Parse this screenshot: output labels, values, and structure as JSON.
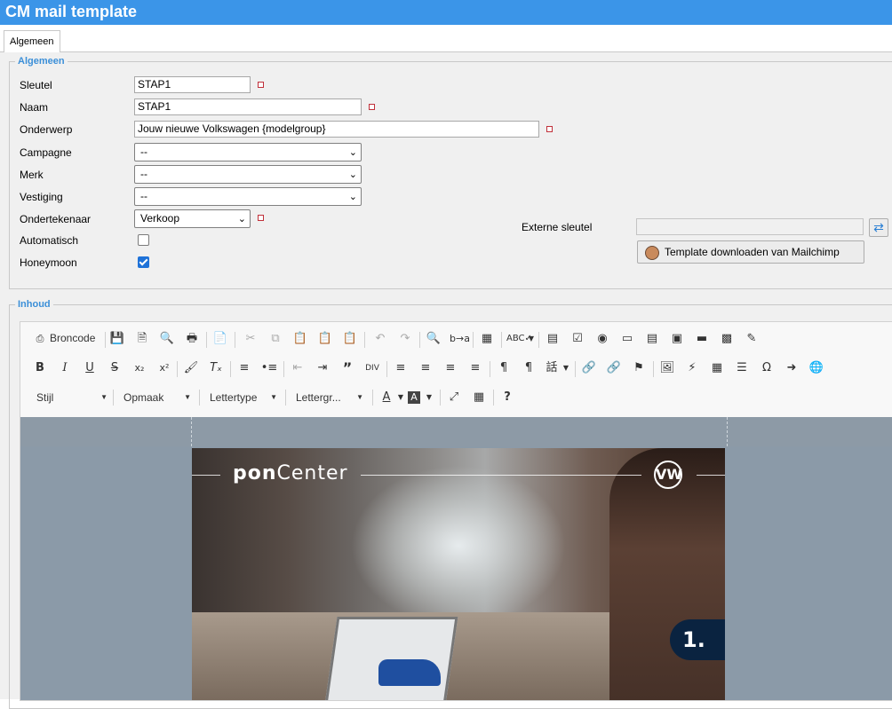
{
  "window": {
    "title": "CM mail template"
  },
  "tabs": [
    {
      "label": "Algemeen"
    }
  ],
  "general_section": {
    "legend": "Algemeen",
    "fields": {
      "sleutel": {
        "label": "Sleutel",
        "value": "STAP1"
      },
      "naam": {
        "label": "Naam",
        "value": "STAP1"
      },
      "onderwerp": {
        "label": "Onderwerp",
        "value": "Jouw nieuwe Volkswagen {modelgroup}"
      },
      "campagne": {
        "label": "Campagne",
        "value": "--"
      },
      "merk": {
        "label": "Merk",
        "value": "--"
      },
      "vestiging": {
        "label": "Vestiging",
        "value": "--"
      },
      "ondertekenaar": {
        "label": "Ondertekenaar",
        "value": "Verkoop"
      },
      "automatisch": {
        "label": "Automatisch",
        "checked": false
      },
      "honeymoon": {
        "label": "Honeymoon",
        "checked": true
      },
      "externe_sleutel": {
        "label": "Externe sleutel",
        "value": ""
      }
    },
    "download_button": {
      "label": "Template downloaden van Mailchimp"
    }
  },
  "content_section": {
    "legend": "Inhoud",
    "toolbar": {
      "source_label": "Broncode",
      "style_combo": "Stijl",
      "format_combo": "Opmaak",
      "font_combo": "Lettertype",
      "size_combo": "Lettergr..."
    },
    "preview": {
      "brand_logo_bold": "pon",
      "brand_logo_light": "Center",
      "vw_logo": "VW",
      "step_badge": "1."
    }
  },
  "colors": {
    "title_bar": "#3b95e8",
    "legend": "#3b8fd8",
    "required_marker": "#c0303a",
    "checkbox_checked": "#1e72d8",
    "step_badge": "#0a2340"
  }
}
